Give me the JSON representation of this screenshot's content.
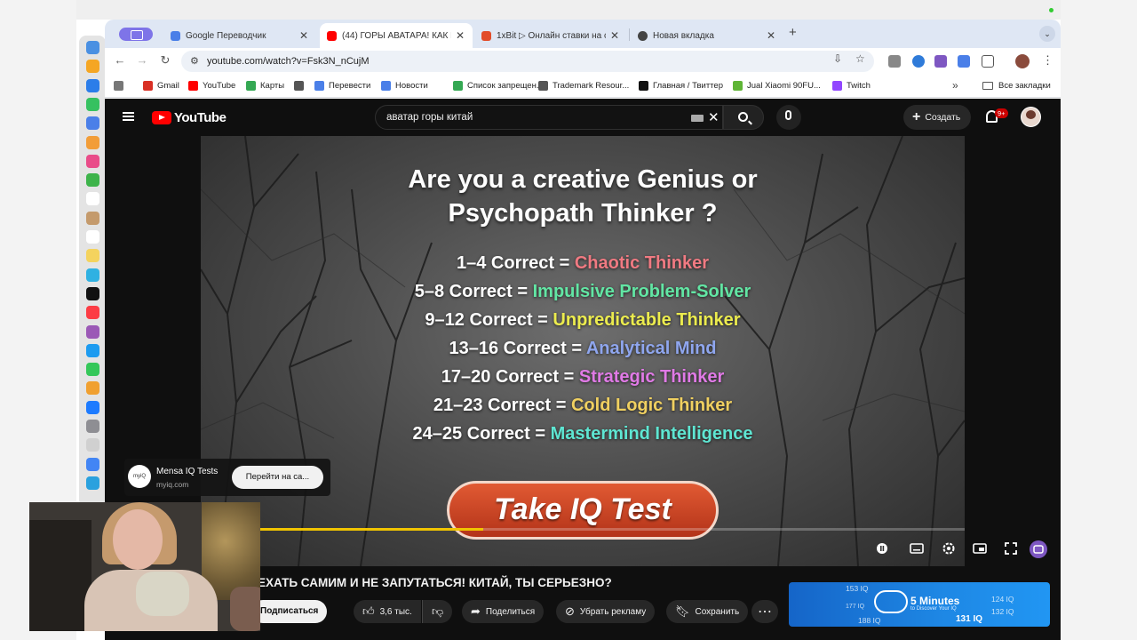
{
  "browser": {
    "tabs": [
      {
        "title": "Google Переводчик",
        "color": "#4a7fe8"
      },
      {
        "title": "(44) ГОРЫ АВАТАРА! КАК П...",
        "color": "#ff0000"
      },
      {
        "title": "1xBit ▷ Онлайн ставки на сп...",
        "color": "#e24c2a"
      },
      {
        "title": "Новая вкладка",
        "color": "#444444"
      }
    ],
    "url": "youtube.com/watch?v=Fsk3N_nCujM",
    "bookmarks": [
      {
        "label": "Gmail",
        "color": "#d93025"
      },
      {
        "label": "YouTube",
        "color": "#ff0000"
      },
      {
        "label": "Карты",
        "color": "#34a853"
      },
      {
        "label": "",
        "color": "#555555"
      },
      {
        "label": "Перевести",
        "color": "#4a7fe8"
      },
      {
        "label": "Новости",
        "color": "#4a7fe8"
      },
      {
        "label": "Список запрещен...",
        "color": "#34a853"
      },
      {
        "label": "Trademark Resour...",
        "color": "#555555"
      },
      {
        "label": "Главная / Твиттер",
        "color": "#111111"
      },
      {
        "label": "Jual Xiaomi 90FU...",
        "color": "#5fb536"
      },
      {
        "label": "Twitch",
        "color": "#9146ff"
      }
    ],
    "all_bookmarks": "Все закладки",
    "more": "»"
  },
  "youtube": {
    "logo": "YouTube",
    "search_query": "аватар горы китай",
    "create_label": "Создать",
    "notif_count": "9+"
  },
  "video": {
    "title_line1": "Are you a creative Genius or",
    "title_line2": "Psychopath Thinker ?",
    "scores": [
      {
        "range": "1–4 Correct = ",
        "result": "Chaotic Thinker",
        "color": "#f07a82"
      },
      {
        "range": "5–8 Correct = ",
        "result": "Impulsive Problem-Solver",
        "color": "#62e6a4"
      },
      {
        "range": "9–12 Correct = ",
        "result": "Unpredictable Thinker",
        "color": "#ecec4e"
      },
      {
        "range": "13–16 Correct = ",
        "result": "Analytical Mind",
        "color": "#8fa6ee"
      },
      {
        "range": "17–20 Correct = ",
        "result": "Strategic Thinker",
        "color": "#e07ae6"
      },
      {
        "range": "21–23 Correct = ",
        "result": "Cold Logic Thinker",
        "color": "#f0d060"
      },
      {
        "range": "24–25 Correct = ",
        "result": "Mastermind Intelligence",
        "color": "#5ee6d2"
      }
    ],
    "cta": "Take IQ Test",
    "progress_fraction": 0.37
  },
  "card": {
    "name": "Mensa IQ Tests",
    "url": "myiq.com",
    "button": "Перейти на са...",
    "logo_text": "myiQ"
  },
  "info": {
    "title": "ЕХАТЬ САМИМ И НЕ ЗАПУТАТЬСЯ! КИТАЙ, ТЫ СЕРЬЕЗНО?",
    "subscribe": "Подписаться",
    "likes": "3,6 тыс.",
    "share": "Поделиться",
    "remove_ads": "Убрать рекламу",
    "save": "Сохранить"
  },
  "ad": {
    "headline": "5 Minutes",
    "sub": "to Discover Your IQ",
    "iq_values": [
      "153 IQ",
      "124 IQ",
      "177 IQ",
      "132 IQ",
      "188 IQ",
      "131 IQ"
    ]
  },
  "dock_colors": [
    "#4a90e2",
    "#f5a623",
    "#2b7de9",
    "#36c160",
    "#4a7fe8",
    "#f29d38",
    "#e94c89",
    "#3db34a",
    "#ffffff",
    "#c49a6c",
    "#ffffff",
    "#f4d35e",
    "#2fb1e2",
    "#111111",
    "#fc3c44",
    "#9b59b6",
    "#1d9bf0",
    "#34c759",
    "#f0a030",
    "#1d7bff",
    "#8e8e93",
    "#d0d0d0",
    "#4285f4",
    "#2aa1de"
  ]
}
